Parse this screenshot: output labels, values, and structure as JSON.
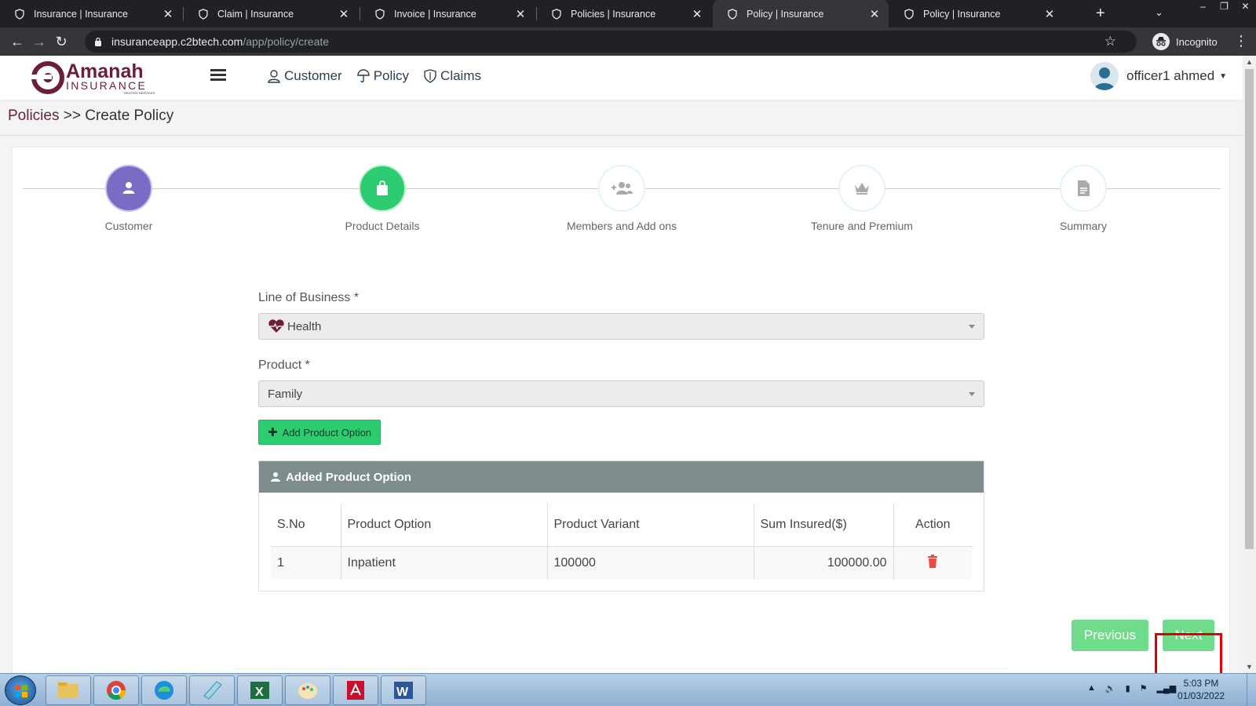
{
  "browser": {
    "tabs": [
      {
        "title": "Insurance | Insurance",
        "active": false
      },
      {
        "title": "Claim | Insurance",
        "active": false
      },
      {
        "title": "Invoice | Insurance",
        "active": false
      },
      {
        "title": "Policies | Insurance",
        "active": false
      },
      {
        "title": "Policy | Insurance",
        "active": true
      },
      {
        "title": "Policy | Insurance",
        "active": false
      }
    ],
    "url_host": "insuranceapp.c2btech.com",
    "url_path": "/app/policy/create",
    "incognito_label": "Incognito"
  },
  "header": {
    "logo_text": "Amanah",
    "logo_sub": "INSURANCE",
    "logo_tag": "TRUSTED SERVICES",
    "nav": [
      {
        "label": "Customer",
        "icon": "user-icon"
      },
      {
        "label": "Policy",
        "icon": "umbrella-icon"
      },
      {
        "label": "Claims",
        "icon": "shield-icon"
      }
    ],
    "user_name": "officer1 ahmed"
  },
  "breadcrumb": {
    "parent": "Policies",
    "separator": ">>",
    "current": "Create Policy"
  },
  "steps": [
    {
      "label": "Customer",
      "icon": "user-icon",
      "state": "done"
    },
    {
      "label": "Product Details",
      "icon": "bag-icon",
      "state": "active"
    },
    {
      "label": "Members and Add ons",
      "icon": "group-icon",
      "state": "pending"
    },
    {
      "label": "Tenure and Premium",
      "icon": "crown-icon",
      "state": "pending"
    },
    {
      "label": "Summary",
      "icon": "document-icon",
      "state": "pending"
    }
  ],
  "form": {
    "line_of_business_label": "Line of Business *",
    "line_of_business_value": "Health",
    "product_label": "Product *",
    "product_value": "Family",
    "add_button": "Add Product Option"
  },
  "product_options": {
    "title": "Added Product Option",
    "columns": [
      "S.No",
      "Product Option",
      "Product Variant",
      "Sum Insured($)",
      "Action"
    ],
    "rows": [
      {
        "sno": "1",
        "option": "Inpatient",
        "variant": "100000",
        "sum_insured": "100000.00"
      }
    ]
  },
  "buttons": {
    "previous": "Previous",
    "next": "Next"
  },
  "taskbar": {
    "time": "5:03 PM",
    "date": "01/03/2022"
  },
  "colors": {
    "brand": "#6b1d3a",
    "success": "#2ecc71",
    "step_done": "#7c6bc4",
    "panel_header": "#7f8c8d",
    "button": "#6fdc8c",
    "highlight": "#e50000"
  }
}
